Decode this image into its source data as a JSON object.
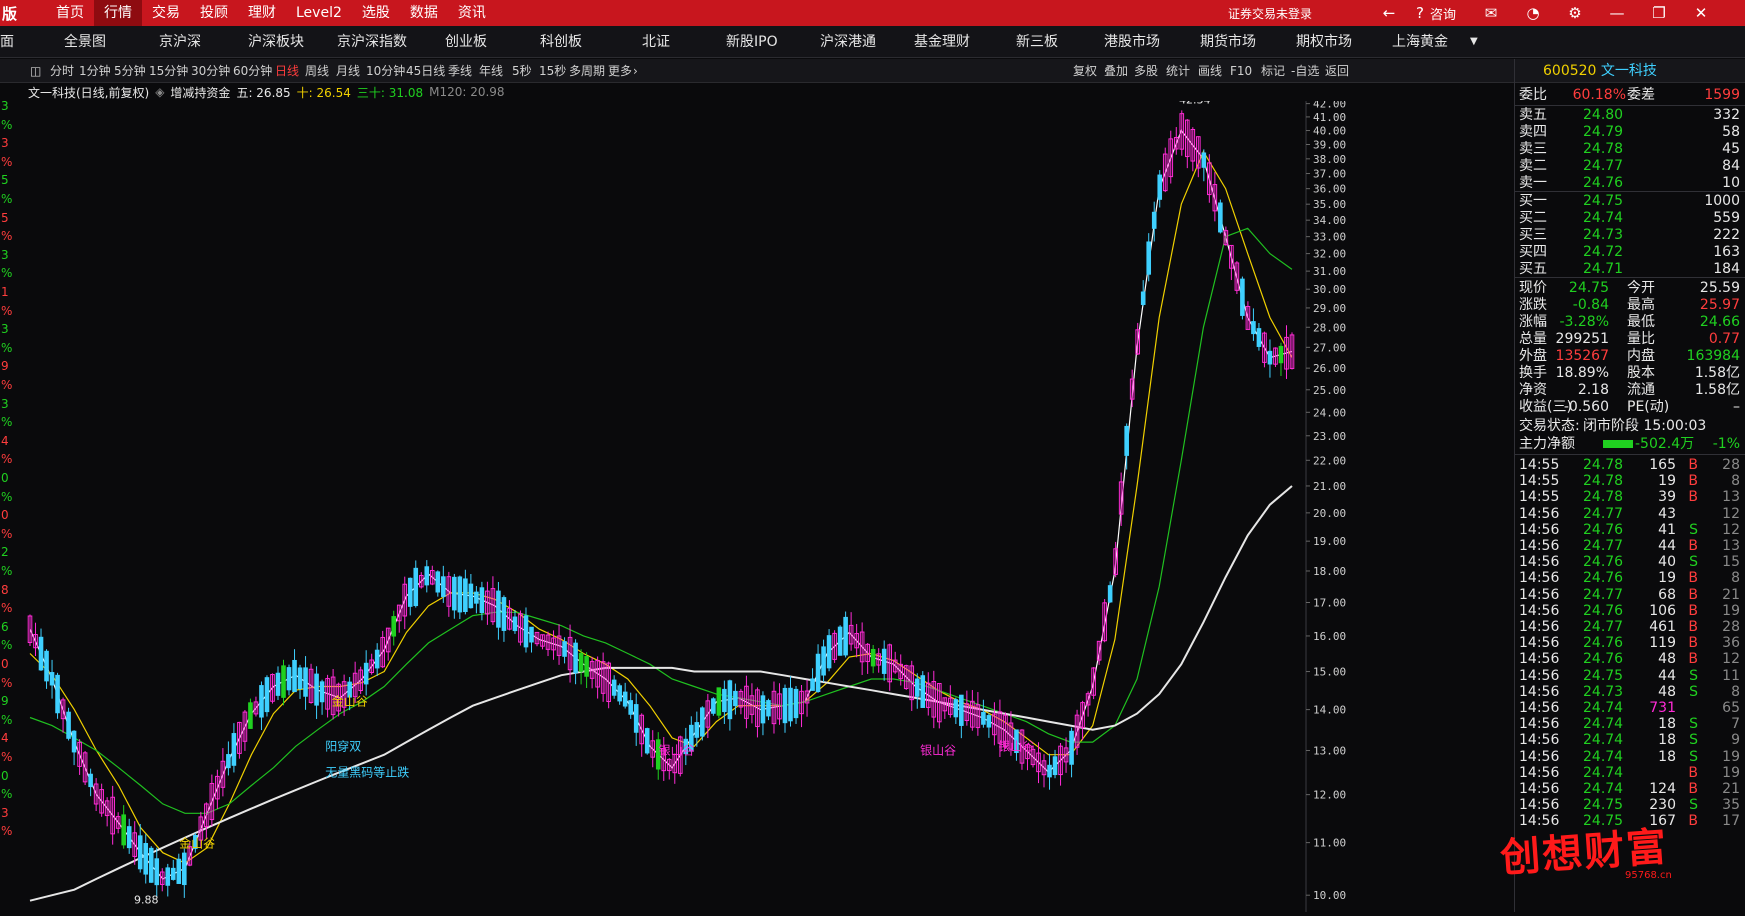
{
  "topbar": {
    "logo": "版",
    "menu": [
      "首页",
      "行情",
      "交易",
      "投顾",
      "理财",
      "Level2",
      "选股",
      "数据",
      "资讯"
    ],
    "active_menu": "行情",
    "login_status": "证券交易未登录",
    "consult": "咨询"
  },
  "marketbar": {
    "items": [
      "面",
      "全景图",
      "京沪深",
      "沪深板块",
      "京沪深指数",
      "创业板",
      "科创板",
      "北证",
      "新股IPO",
      "沪深港通",
      "基金理财",
      "新三板",
      "港股市场",
      "期货市场",
      "期权市场",
      "上海黄金"
    ]
  },
  "toolbar": {
    "periods": [
      "分时",
      "1分钟",
      "5分钟",
      "15分钟",
      "30分钟",
      "60分钟",
      "日线",
      "周线",
      "月线",
      "10分钟",
      "45日线",
      "季线",
      "年线",
      "5秒",
      "15秒",
      "多周期",
      "更多"
    ],
    "active_period": "日线",
    "actions": [
      "复权",
      "叠加",
      "多股",
      "统计",
      "画线",
      "F10",
      "标记",
      "-自选",
      "返回"
    ]
  },
  "infobar": {
    "stock": "文一科技(日线,前复权)",
    "indicator": "增减持资金",
    "ma5_label": "五: 26.85",
    "ma10_label": "十: 26.54",
    "ma30_label": "三十: 31.08",
    "m120_label": "M120: 20.98"
  },
  "left_axis_labels": [
    "3",
    "%",
    "3",
    "%",
    "5",
    "%",
    "5",
    "%",
    "3",
    "%",
    "1",
    "%",
    "3",
    "%",
    "9",
    "%",
    "3",
    "%",
    "4",
    "%",
    "0",
    "%",
    "0",
    "%",
    "2",
    "%",
    "8",
    "%",
    "6",
    "%",
    "0",
    "%",
    "9",
    "%",
    "4",
    "%",
    "0",
    "%",
    "3",
    "%"
  ],
  "chart_data": {
    "type": "candlestick",
    "title": "文一科技(日线,前复权)",
    "y_axis_labels": [
      "42.00",
      "41.00",
      "40.00",
      "39.00",
      "38.00",
      "37.00",
      "36.00",
      "35.00",
      "34.00",
      "33.00",
      "32.00",
      "31.00",
      "30.00",
      "29.00",
      "28.00",
      "27.00",
      "26.00",
      "25.00",
      "24.00",
      "23.00",
      "22.00",
      "21.00",
      "20.00",
      "19.00",
      "18.00",
      "17.00",
      "16.00",
      "15.00",
      "14.00",
      "13.00",
      "12.00",
      "11.00",
      "10.00"
    ],
    "ylim": [
      9.7,
      42.2
    ],
    "scale": "log",
    "high_label": "42.34",
    "low_label": "9.88",
    "annotations": [
      {
        "text": "金山谷",
        "x": 0.121,
        "price": 10.9,
        "color": "#f0d000"
      },
      {
        "text": "金山谷",
        "x": 0.24,
        "price": 14.1,
        "color": "#f0d000"
      },
      {
        "text": "阳穿双",
        "x": 0.235,
        "price": 13.0,
        "color": "#3fd0ff"
      },
      {
        "text": "无量黑码等止跌",
        "x": 0.235,
        "price": 12.4,
        "color": "#3fd0ff"
      },
      {
        "text": "银山谷",
        "x": 0.495,
        "price": 12.9,
        "color": "#ff2bd6"
      },
      {
        "text": "银山谷",
        "x": 0.699,
        "price": 12.9,
        "color": "#ff2bd6"
      },
      {
        "text": "银山谷",
        "x": 0.76,
        "price": 13.0,
        "color": "#ff2bd6"
      }
    ],
    "series": [
      {
        "name": "五",
        "color": "#ffffff",
        "values": [
          16.2,
          14.8,
          13.2,
          12.0,
          11.4,
          10.8,
          10.3,
          10.5,
          11.6,
          12.8,
          13.9,
          14.6,
          14.9,
          14.5,
          14.3,
          14.8,
          15.6,
          17.2,
          17.9,
          17.3,
          17.2,
          16.9,
          16.3,
          15.9,
          15.7,
          15.2,
          14.8,
          14.2,
          13.1,
          12.6,
          13.4,
          14.2,
          14.3,
          14.0,
          14.1,
          14.2,
          15.5,
          16.1,
          15.4,
          15.2,
          14.6,
          14.2,
          14.0,
          13.8,
          13.5,
          13.0,
          12.5,
          13.0,
          14.6,
          18.0,
          27.0,
          36.0,
          40.0,
          38.0,
          33.0,
          28.5,
          26.5,
          26.8
        ]
      },
      {
        "name": "十",
        "color": "#f0d000",
        "values": [
          15.5,
          14.9,
          14.0,
          13.0,
          12.2,
          11.3,
          10.8,
          10.6,
          10.9,
          11.8,
          12.9,
          13.9,
          14.5,
          14.6,
          14.6,
          14.7,
          15.0,
          16.1,
          16.9,
          17.3,
          17.3,
          17.1,
          16.7,
          16.2,
          15.9,
          15.5,
          15.2,
          14.8,
          14.1,
          13.3,
          13.1,
          13.7,
          14.1,
          14.1,
          14.1,
          14.2,
          14.7,
          15.4,
          15.5,
          15.3,
          14.9,
          14.5,
          14.2,
          14.0,
          13.7,
          13.3,
          12.9,
          12.9,
          13.6,
          15.9,
          21.0,
          28.5,
          35.0,
          38.5,
          36.0,
          32.0,
          28.5,
          26.5
        ]
      },
      {
        "name": "三十",
        "color": "#20c020",
        "values": [
          13.8,
          13.6,
          13.3,
          13.0,
          12.6,
          12.2,
          11.8,
          11.6,
          11.6,
          11.8,
          12.2,
          12.6,
          13.1,
          13.5,
          13.9,
          14.2,
          14.6,
          15.2,
          15.8,
          16.2,
          16.6,
          16.7,
          16.7,
          16.5,
          16.3,
          16.0,
          15.8,
          15.5,
          15.2,
          14.8,
          14.6,
          14.4,
          14.3,
          14.2,
          14.1,
          14.2,
          14.4,
          14.6,
          14.8,
          14.8,
          14.7,
          14.5,
          14.3,
          14.1,
          13.9,
          13.7,
          13.4,
          13.2,
          13.2,
          13.6,
          14.8,
          17.5,
          22.0,
          28.0,
          33.0,
          33.5,
          32.0,
          31.1
        ]
      },
      {
        "name": "M120",
        "color": "#e6e6e6",
        "values": [
          9.9,
          10.0,
          10.1,
          10.3,
          10.5,
          10.7,
          10.9,
          11.1,
          11.3,
          11.5,
          11.7,
          11.9,
          12.1,
          12.3,
          12.5,
          12.7,
          12.9,
          13.2,
          13.5,
          13.8,
          14.1,
          14.3,
          14.5,
          14.7,
          14.9,
          15.0,
          15.1,
          15.1,
          15.1,
          15.1,
          15.0,
          15.0,
          15.0,
          15.0,
          14.9,
          14.8,
          14.7,
          14.6,
          14.5,
          14.4,
          14.3,
          14.2,
          14.1,
          14.0,
          13.9,
          13.8,
          13.7,
          13.6,
          13.5,
          13.6,
          13.9,
          14.4,
          15.2,
          16.4,
          17.8,
          19.2,
          20.3,
          21.0
        ]
      }
    ]
  },
  "quote": {
    "code": "600520",
    "name": "文一科技",
    "weibi_label": "委比",
    "weibi": "60.18%",
    "weicha_label": "委差",
    "weicha": "1599",
    "asks": [
      {
        "label": "卖五",
        "price": "24.80",
        "vol": "332"
      },
      {
        "label": "卖四",
        "price": "24.79",
        "vol": "58"
      },
      {
        "label": "卖三",
        "price": "24.78",
        "vol": "45"
      },
      {
        "label": "卖二",
        "price": "24.77",
        "vol": "84"
      },
      {
        "label": "卖一",
        "price": "24.76",
        "vol": "10"
      }
    ],
    "bids": [
      {
        "label": "买一",
        "price": "24.75",
        "vol": "1000"
      },
      {
        "label": "买二",
        "price": "24.74",
        "vol": "559"
      },
      {
        "label": "买三",
        "price": "24.73",
        "vol": "222"
      },
      {
        "label": "买四",
        "price": "24.72",
        "vol": "163"
      },
      {
        "label": "买五",
        "price": "24.71",
        "vol": "184"
      }
    ],
    "stats": [
      {
        "l1": "现价",
        "v1": "24.75",
        "c1": "green",
        "l2": "今开",
        "v2": "25.59",
        "c2": "white"
      },
      {
        "l1": "涨跌",
        "v1": "-0.84",
        "c1": "green",
        "l2": "最高",
        "v2": "25.97",
        "c2": "red"
      },
      {
        "l1": "涨幅",
        "v1": "-3.28%",
        "c1": "green",
        "l2": "最低",
        "v2": "24.66",
        "c2": "green"
      },
      {
        "l1": "总量",
        "v1": "299251",
        "c1": "white",
        "l2": "量比",
        "v2": "0.77",
        "c2": "red"
      },
      {
        "l1": "外盘",
        "v1": "135267",
        "c1": "red",
        "l2": "内盘",
        "v2": "163984",
        "c2": "green"
      },
      {
        "l1": "换手",
        "v1": "18.89%",
        "c1": "white",
        "l2": "股本",
        "v2": "1.58亿",
        "c2": "white"
      },
      {
        "l1": "净资",
        "v1": "2.18",
        "c1": "white",
        "l2": "流通",
        "v2": "1.58亿",
        "c2": "white"
      },
      {
        "l1": "收益(三)",
        "v1": "-0.560",
        "c1": "white",
        "l2": "PE(动)",
        "v2": "–",
        "c2": "white"
      }
    ],
    "status_label": "交易状态:",
    "status_value": "闭市阶段 15:00:03",
    "main_label": "主力净额",
    "main_value": "-502.4万",
    "main_pct": "-1%",
    "ticks": [
      {
        "t": "14:55",
        "p": "24.78",
        "v": "165",
        "s": "B",
        "n": "28"
      },
      {
        "t": "14:55",
        "p": "24.78",
        "v": "19",
        "s": "B",
        "n": "8"
      },
      {
        "t": "14:55",
        "p": "24.78",
        "v": "39",
        "s": "B",
        "n": "13"
      },
      {
        "t": "14:56",
        "p": "24.77",
        "v": "43",
        "s": "",
        "n": "12"
      },
      {
        "t": "14:56",
        "p": "24.76",
        "v": "41",
        "s": "S",
        "n": "12"
      },
      {
        "t": "14:56",
        "p": "24.77",
        "v": "44",
        "s": "B",
        "n": "13"
      },
      {
        "t": "14:56",
        "p": "24.76",
        "v": "40",
        "s": "S",
        "n": "15"
      },
      {
        "t": "14:56",
        "p": "24.76",
        "v": "19",
        "s": "B",
        "n": "8"
      },
      {
        "t": "14:56",
        "p": "24.77",
        "v": "68",
        "s": "B",
        "n": "21"
      },
      {
        "t": "14:56",
        "p": "24.76",
        "v": "106",
        "s": "B",
        "n": "19"
      },
      {
        "t": "14:56",
        "p": "24.77",
        "v": "461",
        "s": "B",
        "n": "28"
      },
      {
        "t": "14:56",
        "p": "24.76",
        "v": "119",
        "s": "B",
        "n": "36"
      },
      {
        "t": "14:56",
        "p": "24.76",
        "v": "48",
        "s": "B",
        "n": "12"
      },
      {
        "t": "14:56",
        "p": "24.75",
        "v": "44",
        "s": "S",
        "n": "11"
      },
      {
        "t": "14:56",
        "p": "24.73",
        "v": "48",
        "s": "S",
        "n": "8"
      },
      {
        "t": "14:56",
        "p": "24.74",
        "v": "731",
        "s": "",
        "n": "65"
      },
      {
        "t": "14:56",
        "p": "24.74",
        "v": "18",
        "s": "S",
        "n": "7"
      },
      {
        "t": "14:56",
        "p": "24.74",
        "v": "18",
        "s": "S",
        "n": "9"
      },
      {
        "t": "14:56",
        "p": "24.74",
        "v": "18",
        "s": "S",
        "n": "19"
      },
      {
        "t": "14:56",
        "p": "24.74",
        "v": "",
        "s": "B",
        "n": "19"
      },
      {
        "t": "14:56",
        "p": "24.74",
        "v": "124",
        "s": "B",
        "n": "21"
      },
      {
        "t": "14:56",
        "p": "24.75",
        "v": "230",
        "s": "S",
        "n": "35"
      },
      {
        "t": "14:56",
        "p": "24.75",
        "v": "167",
        "s": "B",
        "n": "17"
      }
    ]
  },
  "watermark": "创想财富",
  "watermark_url": "95768.cn"
}
